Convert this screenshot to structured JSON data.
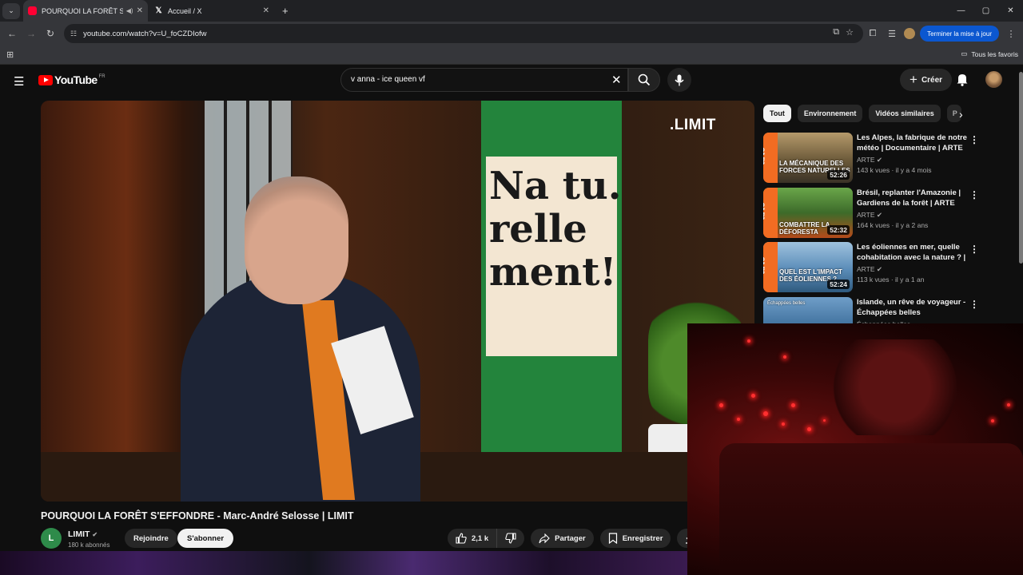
{
  "browser": {
    "tabs": [
      {
        "title": "POURQUOI LA FORÊT S'EFF",
        "active": true
      },
      {
        "title": "Accueil / X",
        "active": false
      }
    ],
    "url": "youtube.com/watch?v=U_foCZDIofw",
    "update_button": "Terminer la mise à jour",
    "bookmarks_label": "Tous les favoris"
  },
  "youtube": {
    "logo_text": "YouTube",
    "country_code": "FR",
    "search_value": "v anna - ice queen vf",
    "create_label": "Créer"
  },
  "video": {
    "overlay_brand": ".LIMIT",
    "poster_text": "Na tu. relle ment!",
    "title": "POURQUOI LA FORÊT S'EFFONDRE - Marc-André Selosse | LIMIT",
    "channel": {
      "name": "LIMIT",
      "initial": "L",
      "subscribers": "180 k abonnés"
    },
    "join_label": "Rejoindre",
    "subscribe_label": "S'abonner",
    "likes": "2,1 k",
    "share_label": "Partager",
    "save_label": "Enregistrer",
    "download_label": "Té"
  },
  "chips": [
    "Tout",
    "Environnement",
    "Vidéos similaires",
    "P"
  ],
  "recommendations": [
    {
      "title": "Les Alpes, la fabrique de notre météo | Documentaire | ARTE",
      "channel": "ARTE",
      "meta": "143 k vues · il y a 4 mois",
      "duration": "52:26",
      "caption": "LA MÉCANIQUE DES FORCES NATURELLES",
      "thumb_color": "#8a7a5a"
    },
    {
      "title": "Brésil, replanter l'Amazonie | Gardiens de la forêt | ARTE",
      "channel": "ARTE",
      "meta": "164 k vues · il y a 2 ans",
      "duration": "52:32",
      "caption": "COMBATTRE LA DÉFORESTA",
      "thumb_color": "#3d6b2a"
    },
    {
      "title": "Les éoliennes en mer, quelle cohabitation avec la nature ? | ...",
      "channel": "ARTE",
      "meta": "113 k vues · il y a 1 an",
      "duration": "52:24",
      "caption": "QUEL EST L'IMPACT DES ÉOLIENNES ?",
      "thumb_color": "#5a8cb8"
    },
    {
      "title": "Islande, un rêve de voyageur - Échappées belles",
      "channel": "Échappées belles",
      "meta": "",
      "duration": "",
      "caption": "Échappées belles",
      "thumb_color": "#3e6f9c"
    }
  ],
  "colors": {
    "youtube_red": "#ff0000",
    "arte_orange": "#f26c22",
    "update_blue": "#0b57d0"
  }
}
